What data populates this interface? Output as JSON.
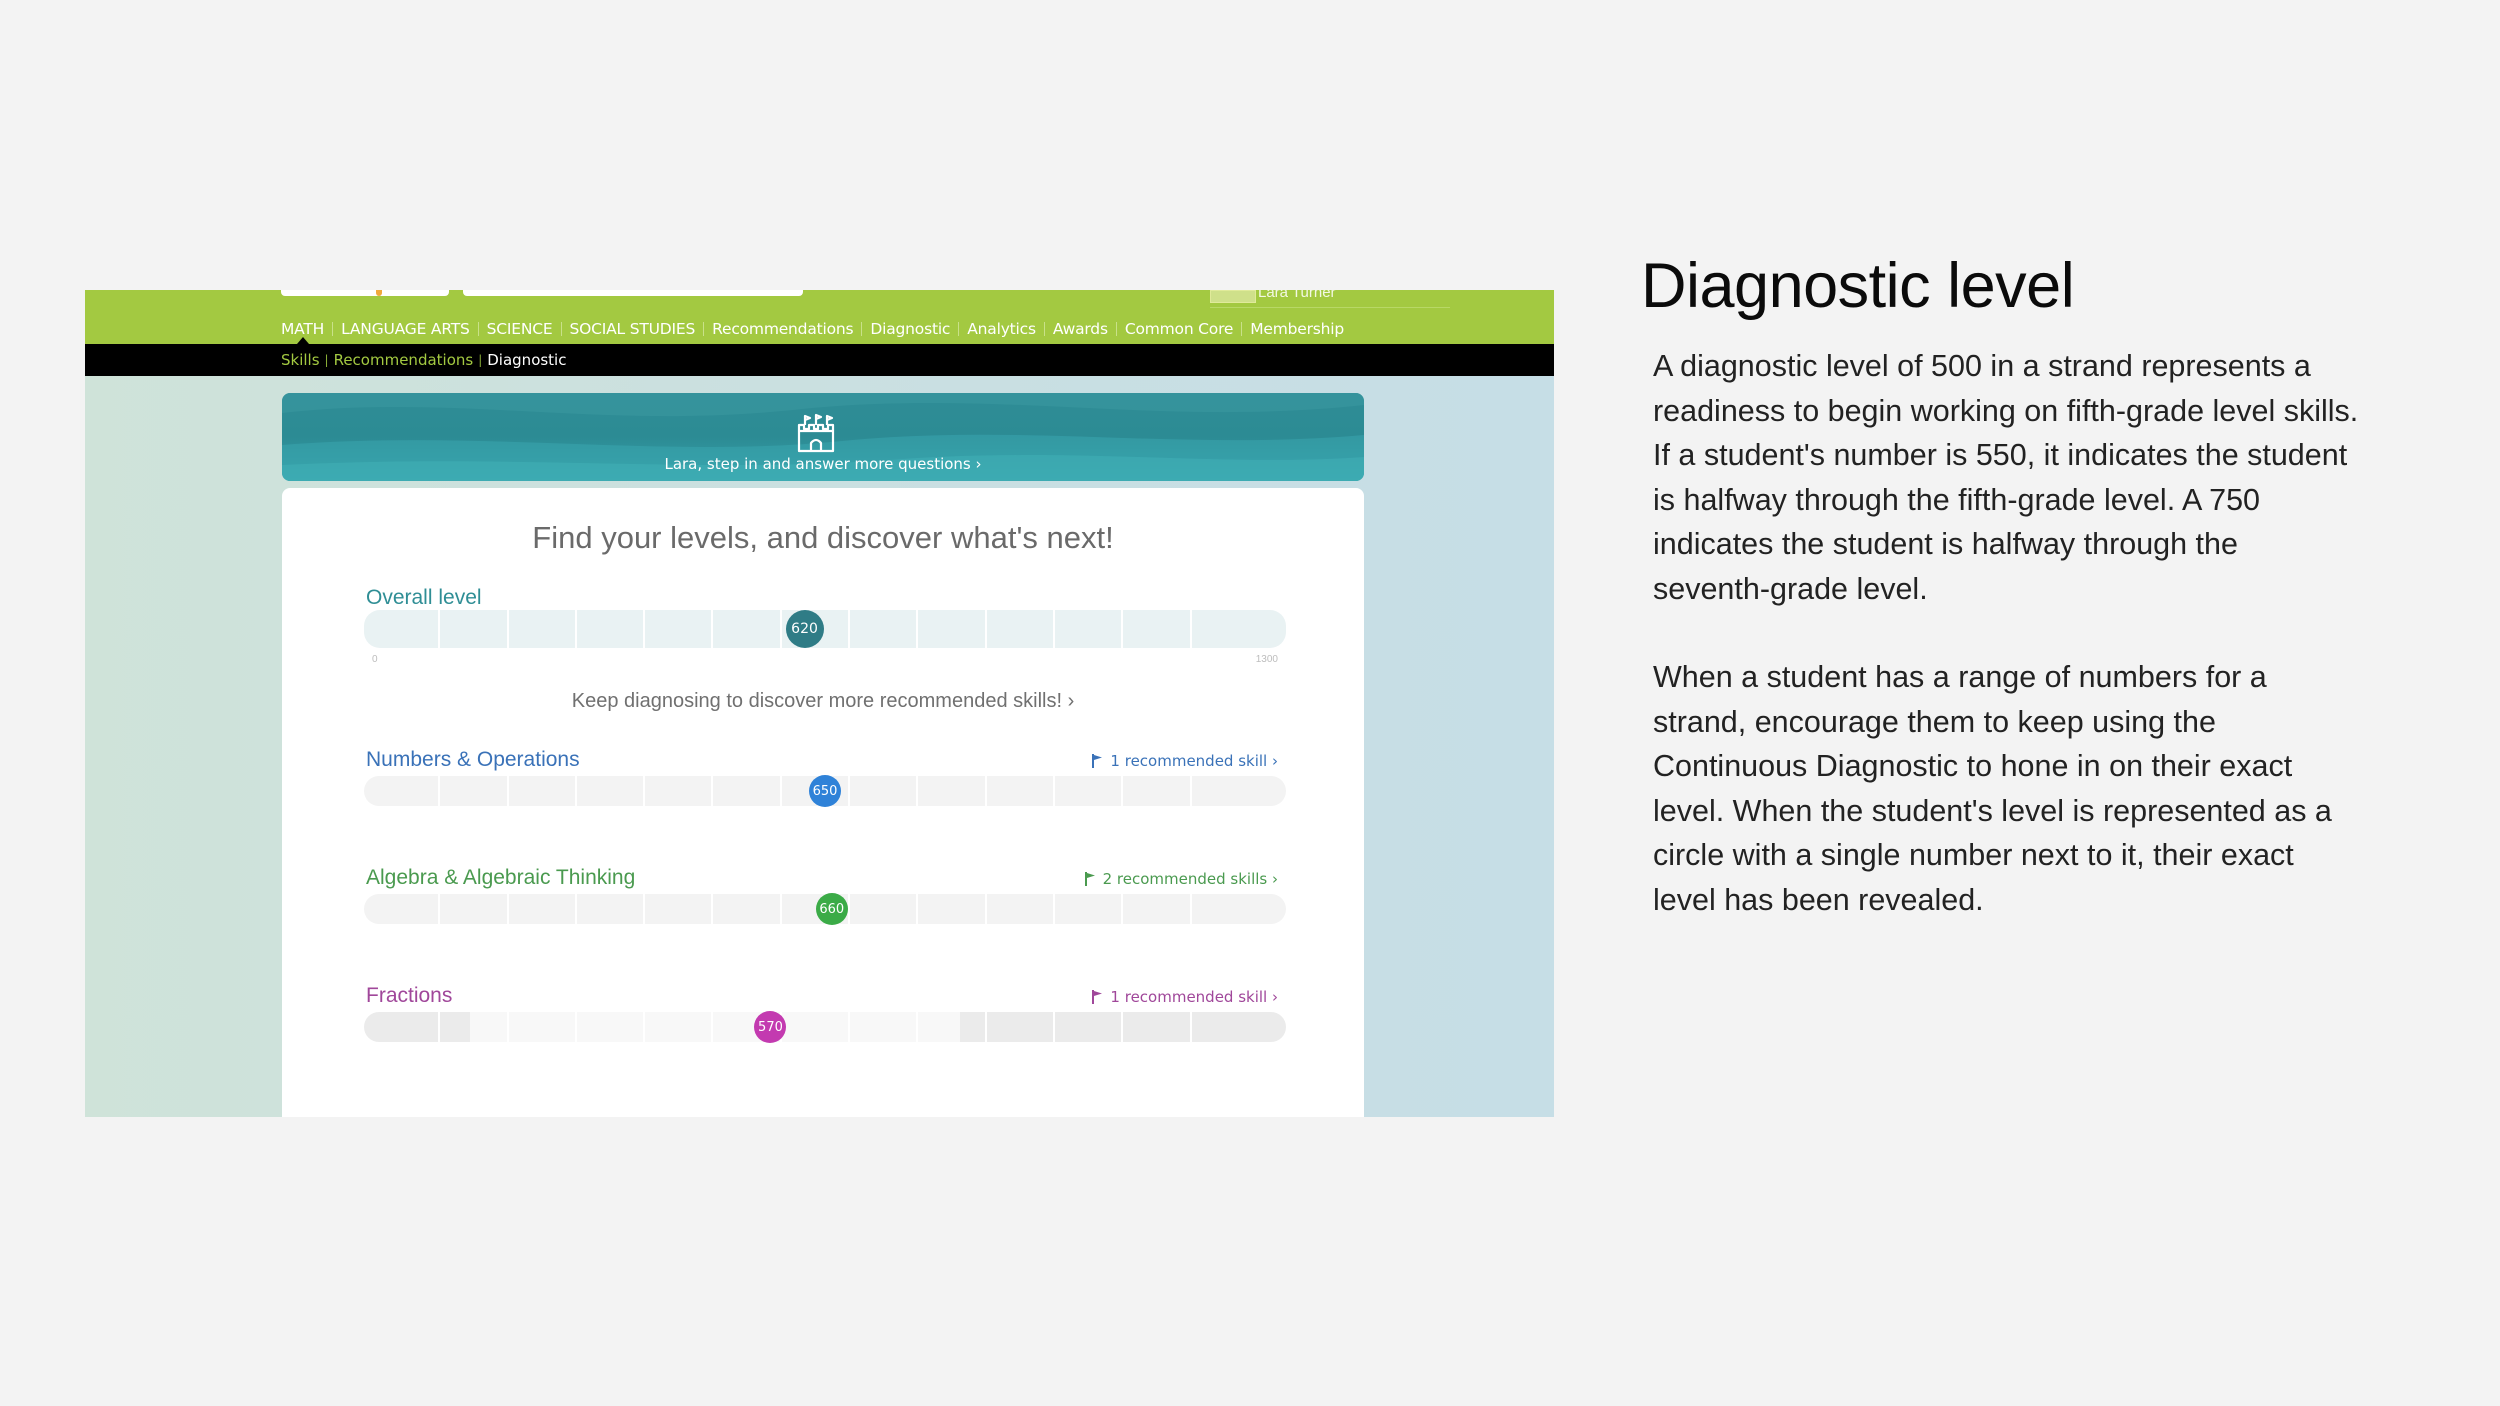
{
  "app": {
    "user_name": "Lara Turner",
    "nav": [
      "MATH",
      "LANGUAGE ARTS",
      "SCIENCE",
      "SOCIAL STUDIES",
      "Recommendations",
      "Diagnostic",
      "Analytics",
      "Awards",
      "Common Core",
      "Membership"
    ],
    "breadcrumbs": [
      "Skills",
      "Recommendations",
      "Diagnostic"
    ],
    "banner_text": "Lara, step in and answer more questions ›",
    "card_title": "Find your levels, and discover what's next!",
    "overall": {
      "label": "Overall level",
      "value": 620,
      "min_label": "0",
      "max_label": "1300",
      "color": "#2f7c86"
    },
    "keep_link": "Keep diagnosing to discover more recommended skills! ›",
    "strands": [
      {
        "name": "Numbers & Operations",
        "rec": "1 recommended skill ›",
        "value": 650,
        "color": "#2f82d8"
      },
      {
        "name": "Algebra & Algebraic Thinking",
        "rec": "2 recommended skills ›",
        "value": 660,
        "color": "#3bab47"
      },
      {
        "name": "Fractions",
        "rec": "1 recommended skill ›",
        "value": 570,
        "color": "#c33ab0",
        "range": [
          150,
          840
        ]
      }
    ],
    "scale_max": 1300
  },
  "panel": {
    "title": "Diagnostic level",
    "paragraphs": [
      "A diagnostic level of 500 in a strand represents a readiness to begin working on fifth-grade level skills. If a student's number is 550, it indicates the student is halfway through the fifth-grade level. A 750 indicates the student is halfway through the seventh-grade level.",
      "When a student has a range of numbers for a strand, encourage them to keep using the Continuous Diagnostic to hone in on their exact level. When the student's level is represented as a circle with a single number next to it, their exact level has been revealed."
    ]
  },
  "colors": {
    "nav_green": "#a3c941",
    "numbers_text": "#3a72b8",
    "algebra_text": "#4a9a4f",
    "fractions_text": "#a0479a",
    "overall_text": "#2f8e95"
  }
}
